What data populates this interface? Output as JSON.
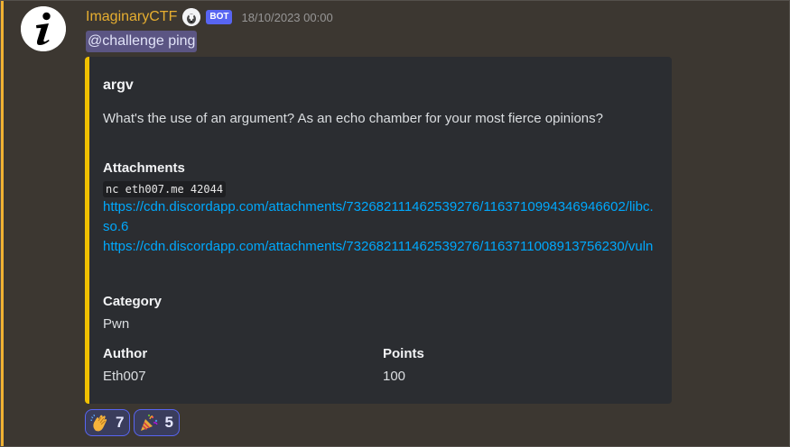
{
  "message": {
    "author": "ImaginaryCTF",
    "bot_tag": "BOT",
    "timestamp": "18/10/2023 00:00",
    "mention": "@challenge ping"
  },
  "embed": {
    "title": "argv",
    "description": "What's the use of an argument? As an echo chamber for your most fierce opinions?",
    "accent_color": "#f0c000",
    "fields": {
      "attachments": {
        "name": "Attachments",
        "command": "nc eth007.me 42044",
        "links": [
          "https://cdn.discordapp.com/attachments/732682111462539276/1163710994346946602/libc.so.6",
          "https://cdn.discordapp.com/attachments/732682111462539276/1163711008913756230/vuln"
        ]
      },
      "category": {
        "name": "Category",
        "value": "Pwn"
      },
      "author": {
        "name": "Author",
        "value": "Eth007"
      },
      "points": {
        "name": "Points",
        "value": "100"
      }
    }
  },
  "reactions": [
    {
      "emoji": "clapping-hands-icon",
      "count": "7"
    },
    {
      "emoji": "party-popper-icon",
      "count": "5"
    }
  ],
  "colors": {
    "author_name": "#e6ae30",
    "bot_tag": "#5865f2",
    "link": "#00a8fc",
    "embed_bg": "#2b2d31",
    "mention_bg": "#5b5583"
  }
}
